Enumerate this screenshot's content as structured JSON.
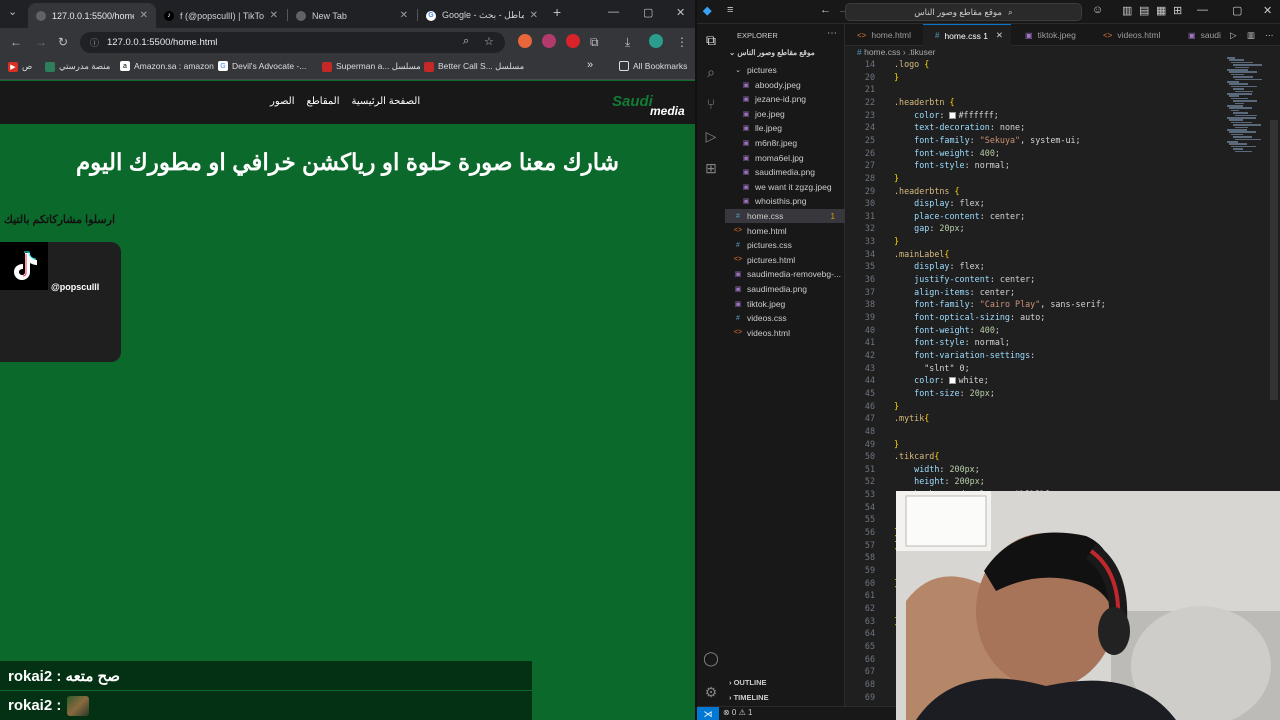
{
  "browser": {
    "tabs": [
      {
        "title": "127.0.0.1:5500/home.ht",
        "active": true
      },
      {
        "title": "f (@popscullI) | TikTok",
        "active": false
      },
      {
        "title": "New Tab",
        "active": false
      },
      {
        "title": "Google - مماطل - بحث",
        "active": false
      }
    ],
    "url": "127.0.0.1:5500/home.html",
    "bookmarks": [
      {
        "label": "ص"
      },
      {
        "label": "منصة مدرستي"
      },
      {
        "label": "Amazon.sa : amazon"
      },
      {
        "label": "Devil's Advocate -..."
      },
      {
        "label": "Superman a... مسلسل"
      },
      {
        "label": "Better Call S... مسلسل"
      }
    ],
    "all_bookmarks": "All Bookmarks"
  },
  "site": {
    "nav": [
      "الصفحة الرئيسية",
      "المقاطع",
      "الصور"
    ],
    "logo_top": "Saudi",
    "logo_bottom": "media",
    "headline": "شارك معنا صورة حلوة او رياكشن خرافي او مطورك اليوم",
    "send_label": "ارسلوا مشاركاتكم بالتيك",
    "tiktok_user": "@popscullI",
    "chat": [
      {
        "text": "rokai2 : صح متعه"
      },
      {
        "text": "rokai2 :"
      }
    ]
  },
  "vscode": {
    "search": "موقع مقاطع وصور الناس",
    "explorer_title": "EXPLORER",
    "project": "موقع مقاطع وصور الناس",
    "folder": "pictures",
    "files_in_folder": [
      "aboody.jpeg",
      "jezane-id.png",
      "joe.jpeg",
      "lle.jpeg",
      "m6n8r.jpeg",
      "moma6el.jpg",
      "saudimedia.png",
      "we want it zgzg.jpeg",
      "whoisthis.png"
    ],
    "files": [
      {
        "name": "home.css",
        "kind": "css",
        "badge": "1",
        "selected": true
      },
      {
        "name": "home.html",
        "kind": "html"
      },
      {
        "name": "pictures.css",
        "kind": "css"
      },
      {
        "name": "pictures.html",
        "kind": "html"
      },
      {
        "name": "saudimedia-removebg-...",
        "kind": "img"
      },
      {
        "name": "saudimedia.png",
        "kind": "img"
      },
      {
        "name": "tiktok.jpeg",
        "kind": "img"
      },
      {
        "name": "videos.css",
        "kind": "css"
      },
      {
        "name": "videos.html",
        "kind": "html"
      }
    ],
    "outline": "OUTLINE",
    "timeline": "TIMELINE",
    "editor_tabs": [
      "home.html",
      "home.css 1",
      "tiktok.jpeg",
      "videos.html",
      "saudi"
    ],
    "breadcrumb": "home.css › .tikuser",
    "status_problems": "⊗ 0 ⚠ 1",
    "code_lines": [
      {
        "n": "14",
        "t": ".logo {"
      },
      {
        "n": "20",
        "t": "}"
      },
      {
        "n": "21",
        "t": ""
      },
      {
        "n": "22",
        "t": ".headerbtn {"
      },
      {
        "n": "23",
        "t": "    color: #ffffff;"
      },
      {
        "n": "24",
        "t": "    text-decoration: none;"
      },
      {
        "n": "25",
        "t": "    font-family: \"Sekuya\", system-ui;"
      },
      {
        "n": "26",
        "t": "    font-weight: 400;"
      },
      {
        "n": "27",
        "t": "    font-style: normal;"
      },
      {
        "n": "28",
        "t": "}"
      },
      {
        "n": "29",
        "t": ".headerbtns {"
      },
      {
        "n": "30",
        "t": "    display: flex;"
      },
      {
        "n": "31",
        "t": "    place-content: center;"
      },
      {
        "n": "32",
        "t": "    gap: 20px;"
      },
      {
        "n": "33",
        "t": "}"
      },
      {
        "n": "34",
        "t": ".mainLabel{"
      },
      {
        "n": "35",
        "t": "    display: flex;"
      },
      {
        "n": "36",
        "t": "    justify-content: center;"
      },
      {
        "n": "37",
        "t": "    align-items: center;"
      },
      {
        "n": "38",
        "t": "    font-family: \"Cairo Play\", sans-serif;"
      },
      {
        "n": "39",
        "t": "    font-optical-sizing: auto;"
      },
      {
        "n": "40",
        "t": "    font-weight: 400;"
      },
      {
        "n": "41",
        "t": "    font-style: normal;"
      },
      {
        "n": "42",
        "t": "    font-variation-settings:"
      },
      {
        "n": "43",
        "t": "      \"slnt\" 0;"
      },
      {
        "n": "44",
        "t": "    color: white;"
      },
      {
        "n": "45",
        "t": "    font-size: 20px;"
      },
      {
        "n": "46",
        "t": "}"
      },
      {
        "n": "47",
        "t": ".mytik{"
      },
      {
        "n": "48",
        "t": ""
      },
      {
        "n": "49",
        "t": "}"
      },
      {
        "n": "50",
        "t": ".tikcard{"
      },
      {
        "n": "51",
        "t": "    width: 200px;"
      },
      {
        "n": "52",
        "t": "    height: 200px;"
      },
      {
        "n": "53",
        "t": "    background-color: #1f1f1f;"
      },
      {
        "n": "54",
        "t": ""
      },
      {
        "n": "55",
        "t": ""
      },
      {
        "n": "56",
        "t": "}"
      },
      {
        "n": "57",
        "t": "}"
      },
      {
        "n": "58",
        "t": ""
      },
      {
        "n": "59",
        "t": ""
      },
      {
        "n": "60",
        "t": "}"
      },
      {
        "n": "61",
        "t": ""
      },
      {
        "n": "62",
        "t": ""
      },
      {
        "n": "63",
        "t": "}"
      },
      {
        "n": "64",
        "t": ""
      },
      {
        "n": "65",
        "t": ""
      },
      {
        "n": "66",
        "t": ""
      },
      {
        "n": "67",
        "t": ""
      },
      {
        "n": "68",
        "t": ""
      },
      {
        "n": "69",
        "t": ""
      }
    ]
  },
  "colors": {
    "page_green": "#0b6a2b",
    "accent": "#0078d4"
  }
}
